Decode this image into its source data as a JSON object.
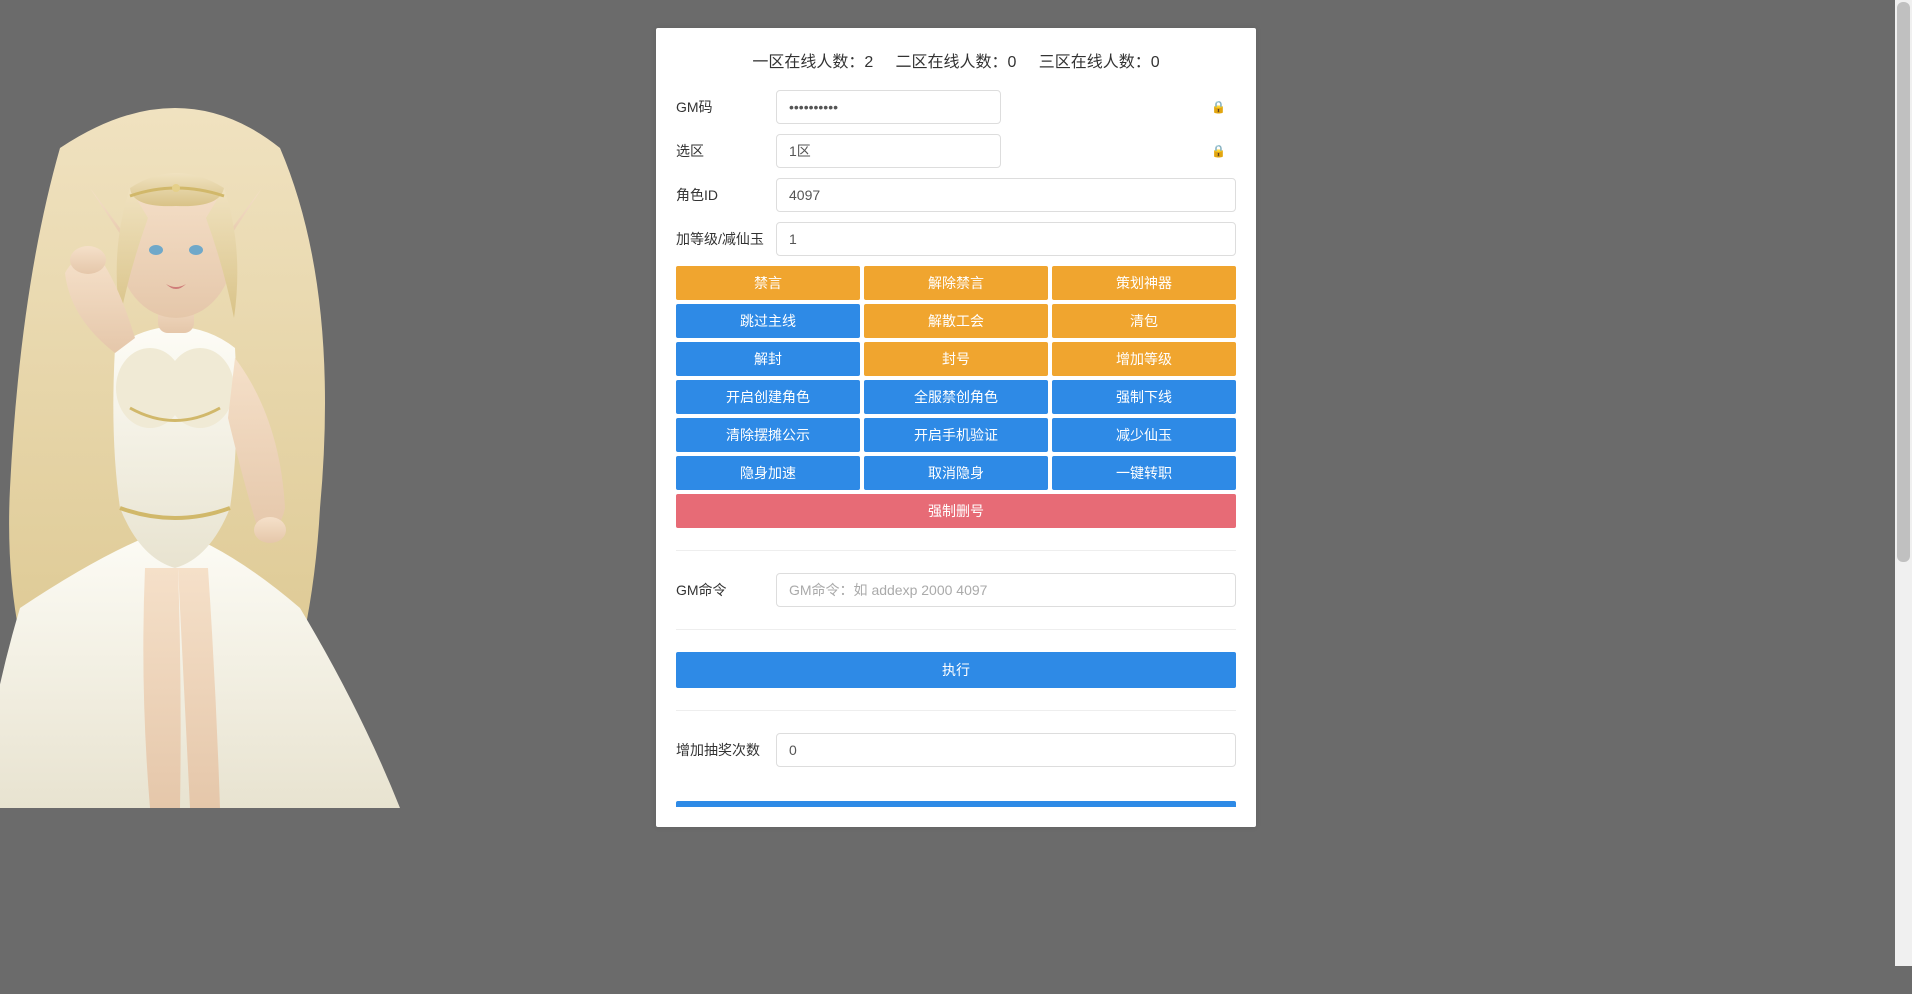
{
  "header": {
    "zone1_label": "一区在线人数：",
    "zone1_count": "2",
    "zone2_label": "二区在线人数：",
    "zone2_count": "0",
    "zone3_label": "三区在线人数：",
    "zone3_count": "0"
  },
  "form": {
    "gm_code_label": "GM码",
    "gm_code_value": "••••••••••",
    "zone_label": "选区",
    "zone_value": "1区",
    "role_id_label": "角色ID",
    "role_id_value": "4097",
    "level_label": "加等级/减仙玉",
    "level_value": "1",
    "gm_cmd_label": "GM命令",
    "gm_cmd_placeholder": "GM命令：如 addexp 2000 4097",
    "lottery_label": "增加抽奖次数",
    "lottery_value": "0"
  },
  "buttons": {
    "r1c1": "禁言",
    "r1c2": "解除禁言",
    "r1c3": "策划神器",
    "r2c1": "跳过主线",
    "r2c2": "解散工会",
    "r2c3": "清包",
    "r3c1": "解封",
    "r3c2": "封号",
    "r3c3": "增加等级",
    "r4c1": "开启创建角色",
    "r4c2": "全服禁创角色",
    "r4c3": "强制下线",
    "r5c1": "清除摆摊公示",
    "r5c2": "开启手机验证",
    "r5c3": "减少仙玉",
    "r6c1": "隐身加速",
    "r6c2": "取消隐身",
    "r6c3": "一键转职",
    "force_delete": "强制删号",
    "execute": "执行"
  }
}
